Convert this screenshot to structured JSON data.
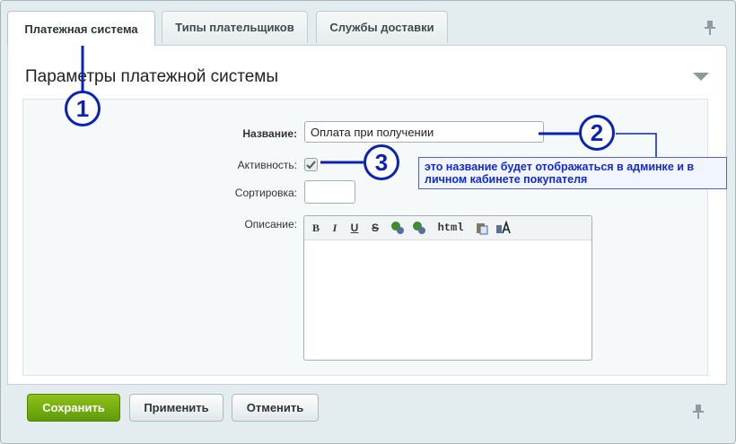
{
  "tabs": [
    {
      "label": "Платежная система",
      "active": true
    },
    {
      "label": "Типы плательщиков",
      "active": false
    },
    {
      "label": "Службы доставки",
      "active": false
    }
  ],
  "panel": {
    "title": "Параметры платежной системы"
  },
  "form": {
    "name_label": "Название:",
    "name_value": "Оплата при получении",
    "active_label": "Активность:",
    "active_checked": true,
    "sort_label": "Сортировка:",
    "sort_value": "",
    "description_label": "Описание:"
  },
  "editor_toolbar": {
    "bold": "B",
    "italic": "I",
    "underline": "U",
    "strike": "S",
    "html": "html"
  },
  "buttons": {
    "save": "Сохранить",
    "apply": "Применить",
    "cancel": "Отменить"
  },
  "annotations": {
    "marker1": "1",
    "marker2": "2",
    "marker3": "3",
    "note": "это название будет отображаться в админке и в личном кабинете покупателя"
  },
  "colors": {
    "accent": "#0b23b3",
    "save_button": "#6fa80b"
  }
}
